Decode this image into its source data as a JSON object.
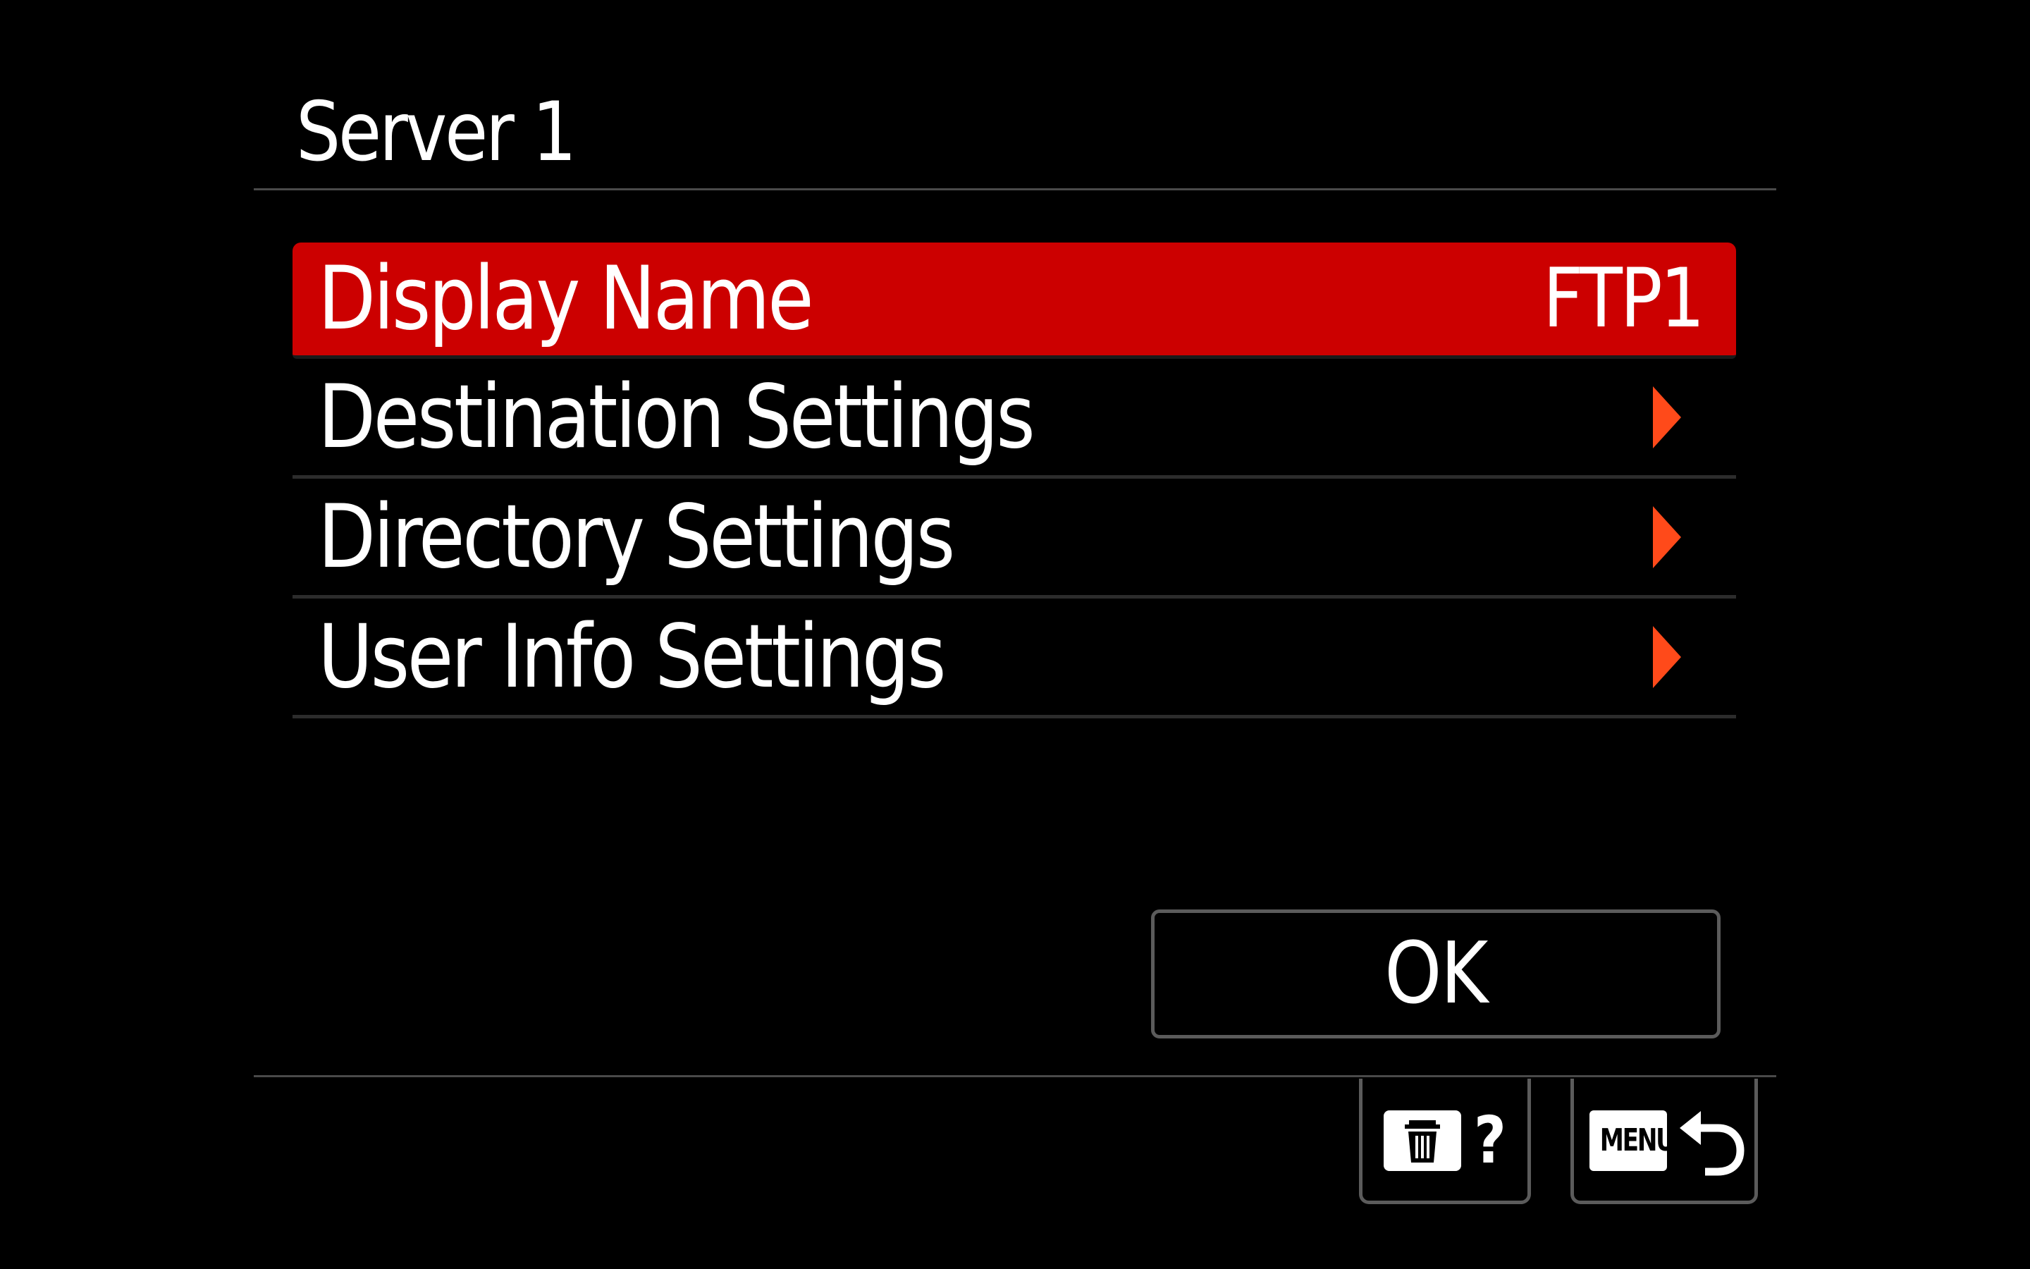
{
  "screen": {
    "title": "Server 1"
  },
  "menu": {
    "items": [
      {
        "label": "Display Name",
        "value": "FTP1",
        "selected": true
      },
      {
        "label": "Destination Settings",
        "submenu": true
      },
      {
        "label": "Directory Settings",
        "submenu": true
      },
      {
        "label": "User Info Settings",
        "submenu": true
      }
    ]
  },
  "actions": {
    "ok_label": "OK"
  },
  "softkeys": {
    "delete": {
      "icon": "trash-icon",
      "help_glyph": "?"
    },
    "menu": {
      "badge": "MENU",
      "icon": "return-arrow-icon"
    }
  },
  "colors": {
    "selection": "#cc0000",
    "submenu_arrow": "#ff4a1a",
    "background": "#000000"
  }
}
